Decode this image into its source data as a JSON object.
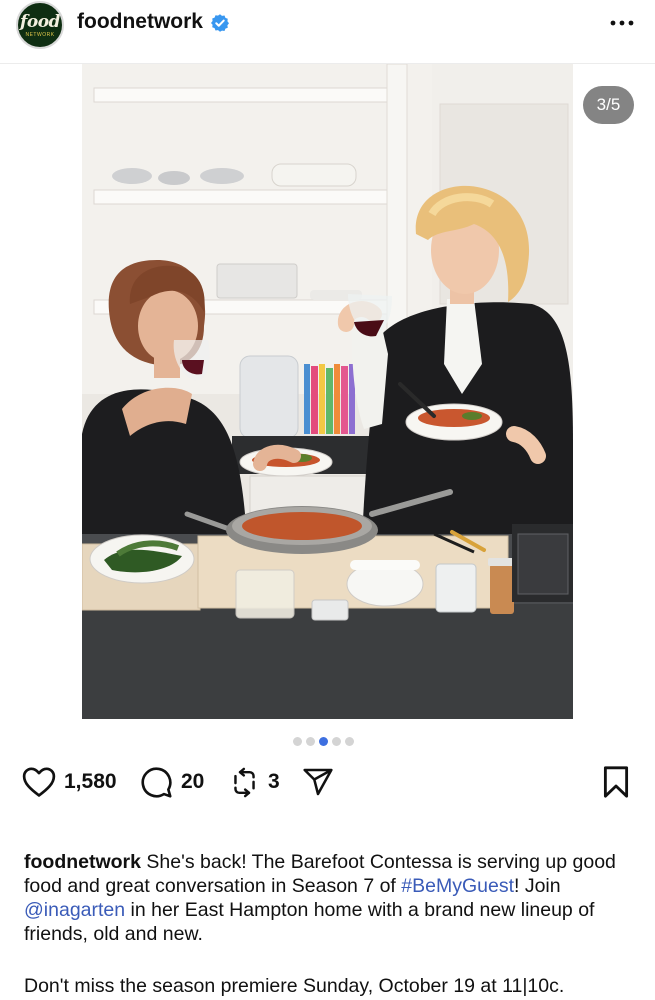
{
  "header": {
    "avatar_text": "food",
    "avatar_subtext": "NETWORK",
    "username": "foodnetwork",
    "verified_icon": "verified-badge-icon",
    "more_icon": "more-options-icon",
    "verified_color": "#3897f0"
  },
  "media": {
    "counter": "3/5",
    "total_slides": 5,
    "active_slide": 3,
    "accent": "#3d6fe0"
  },
  "actions": {
    "likes": "1,580",
    "comments": "20",
    "reposts": "3",
    "icons": [
      "heart-icon",
      "comment-icon",
      "repost-icon",
      "share-icon",
      "bookmark-icon"
    ]
  },
  "caption": {
    "username": "foodnetwork",
    "text_1": " She's back! The Barefoot Contessa is serving up good food and great conversation in Season 7 of ",
    "hashtag": "#BeMyGuest",
    "text_2": "! Join ",
    "mention": "@inagarten",
    "text_3": " in her East Hampton home with a brand new lineup of friends, old and new.",
    "paragraph_2": "Don't miss the season premiere Sunday, October 19 at 11|10c.",
    "link_color": "#3a5bb8"
  }
}
